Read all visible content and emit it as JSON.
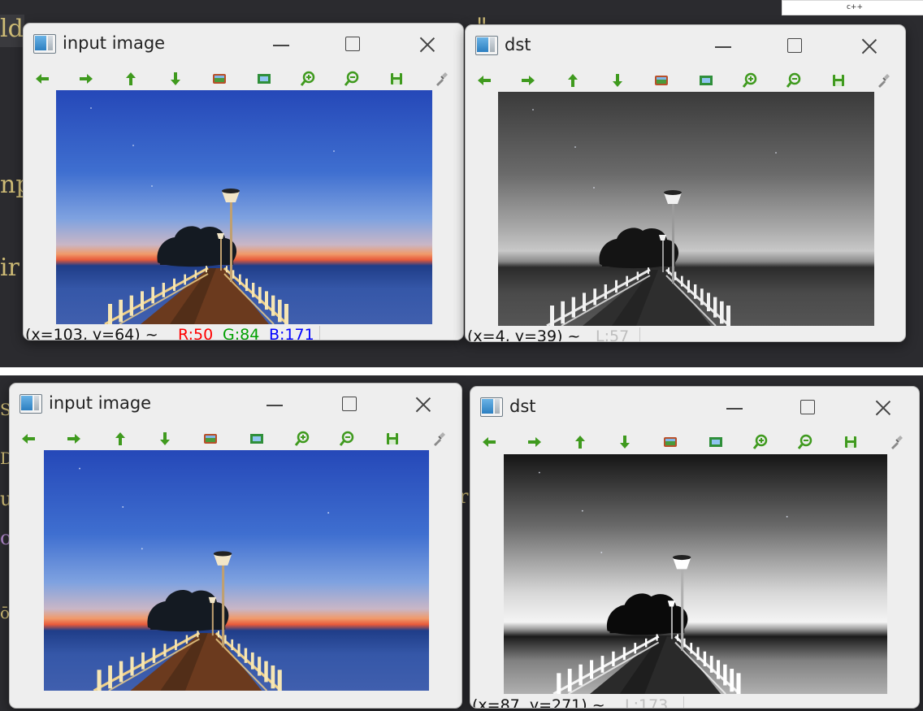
{
  "language_tag": "c++",
  "editor_top": {
    "code_lines": [
      "ld",
      "np",
      "ir",
      "\""
    ]
  },
  "editor_bottom": {
    "code_lines": [
      "S",
      "D",
      "u",
      "ō",
      "o",
      "r"
    ]
  },
  "windows": {
    "top_input": {
      "title": "input image",
      "status": {
        "coords": "(x=103, y=64) ~",
        "r": "R:50",
        "g": "G:84",
        "b": "B:171"
      }
    },
    "top_dst": {
      "title": "dst",
      "status": {
        "coords": "(x=4, y=39) ~",
        "l": "L:57"
      }
    },
    "bottom_input": {
      "title": "input image"
    },
    "bottom_dst": {
      "title": "dst",
      "status": {
        "coords": "(x=87, y=271) ~",
        "l": "L:173"
      }
    }
  },
  "toolbar_icons": [
    "pan-left-icon",
    "pan-right-icon",
    "pan-up-icon",
    "pan-down-icon",
    "zoom-in-image-icon",
    "zoom-fit-icon",
    "zoom-in-icon",
    "zoom-out-icon",
    "save-icon",
    "properties-icon"
  ],
  "colors": {
    "toolbar_green": "#3f9a1e",
    "status_red": "#ff0000",
    "status_green": "#00a000",
    "status_blue": "#0000ff",
    "editor_bg": "#2b2b2f"
  }
}
